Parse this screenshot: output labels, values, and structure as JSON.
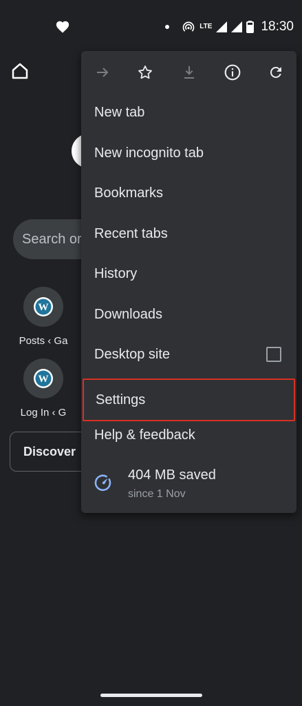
{
  "status_bar": {
    "time": "18:30",
    "network": "LTE"
  },
  "background": {
    "search_placeholder": "Search or type web address",
    "tiles": [
      {
        "label": "Posts ‹ Ga",
        "icon": "wordpress-icon"
      },
      {
        "label": "Log In ‹ G",
        "icon": "wordpress-icon"
      }
    ],
    "discover_label": "Discover"
  },
  "menu": {
    "toolbar": [
      {
        "name": "forward-button",
        "icon": "arrow-forward-icon",
        "enabled": false
      },
      {
        "name": "bookmark-star-button",
        "icon": "star-outline-icon",
        "enabled": true
      },
      {
        "name": "download-page-button",
        "icon": "download-icon",
        "enabled": false
      },
      {
        "name": "page-info-button",
        "icon": "info-icon",
        "enabled": true
      },
      {
        "name": "reload-button",
        "icon": "refresh-icon",
        "enabled": true
      }
    ],
    "items": [
      {
        "label": "New tab"
      },
      {
        "label": "New incognito tab"
      },
      {
        "label": "Bookmarks"
      },
      {
        "label": "Recent tabs"
      },
      {
        "label": "History"
      },
      {
        "label": "Downloads"
      },
      {
        "label": "Desktop site",
        "checked": false
      },
      {
        "label": "Settings",
        "highlighted": true
      },
      {
        "label": "Help & feedback"
      }
    ],
    "data_saver": {
      "amount": "404 MB saved",
      "since": "since 1 Nov",
      "icon": "speedometer-icon",
      "icon_color": "#8ab4f8"
    }
  },
  "colors": {
    "background": "#202124",
    "menu": "#303134",
    "highlight_border": "#d93025",
    "wordpress": "#21759b"
  }
}
